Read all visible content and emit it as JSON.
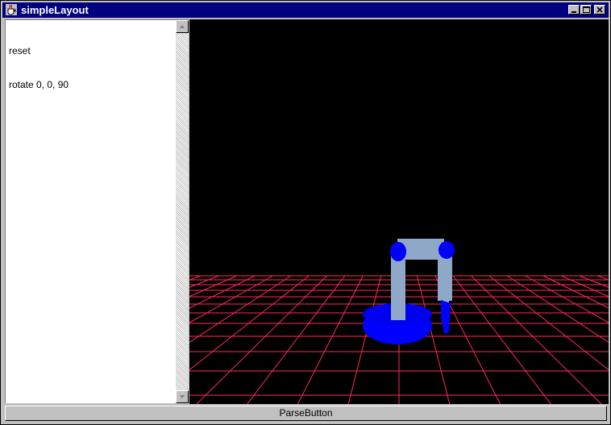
{
  "window": {
    "title": "simpleLayout",
    "controls": [
      "minimize",
      "maximize",
      "close"
    ]
  },
  "editor": {
    "lines": [
      "reset",
      "rotate 0, 0, 90"
    ]
  },
  "scene": {
    "background_color": "#000000",
    "grid_color": "#ff2a55",
    "robot_joint_color": "#0000ff",
    "robot_link_color": "#8fa8c8",
    "icons": [
      "robot-arm-icon",
      "ground-grid-icon"
    ]
  },
  "parse_button": {
    "label": "ParseButton"
  },
  "colors": {
    "titlebar": "#000080",
    "chrome": "#c0c0c0"
  }
}
